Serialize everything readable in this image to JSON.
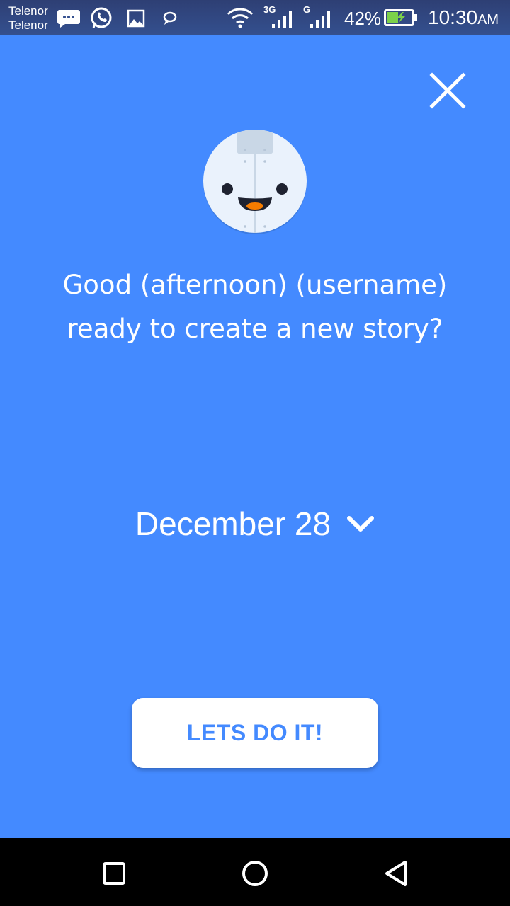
{
  "status_bar": {
    "carrier_1": "Telenor",
    "carrier_2": "Telenor",
    "network_1": "3G",
    "network_2": "G",
    "battery_percent": "42%",
    "time": "10:30",
    "time_suffix": "AM",
    "icons": [
      "messages-icon",
      "whatsapp-icon",
      "gallery-icon",
      "chat-icon",
      "wifi-icon",
      "signal-3g-icon",
      "signal-g-icon",
      "battery-charging-icon"
    ]
  },
  "main": {
    "close_icon": "close-icon",
    "mascot": "smiling-robot-mascot",
    "greeting_line_1": "Good (afternoon) (username)",
    "greeting_line_2": "ready to create a new story?",
    "date_label": "December 28",
    "date_chevron_icon": "chevron-down-icon",
    "cta_label": "LETS DO IT!"
  },
  "nav_bar": {
    "recents_icon": "square-recents-icon",
    "home_icon": "circle-home-icon",
    "back_icon": "triangle-back-icon"
  },
  "colors": {
    "background": "#448AFF",
    "status_bar": "#34508F",
    "button_bg": "#FFFFFF",
    "button_text": "#448AFF",
    "nav_bar": "#000000"
  }
}
